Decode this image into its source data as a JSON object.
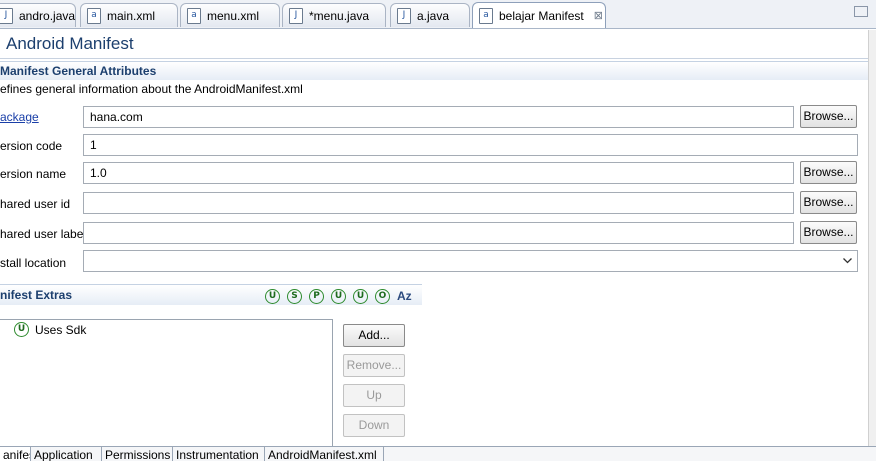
{
  "editor_tabs": [
    {
      "label": "andro.java",
      "icon": "java-file-icon"
    },
    {
      "label": "main.xml",
      "icon": "xml-file-icon"
    },
    {
      "label": "menu.xml",
      "icon": "xml-file-icon"
    },
    {
      "label": "*menu.java",
      "icon": "java-file-icon"
    },
    {
      "label": "a.java",
      "icon": "java-file-icon"
    },
    {
      "label": "belajar Manifest",
      "icon": "manifest-file-icon",
      "active": true
    }
  ],
  "close_glyph": "⊠",
  "title": "Android Manifest",
  "general": {
    "heading": "Manifest General Attributes",
    "description": "efines general information about the AndroidManifest.xml",
    "package_label": "ackage",
    "package_value": "hana.com",
    "version_code_label": "ersion code",
    "version_code_value": "1",
    "version_name_label": "ersion name",
    "version_name_value": "1.0",
    "shared_user_id_label": "hared user id",
    "shared_user_id_value": "",
    "shared_user_label_label": "hared user label",
    "shared_user_label_value": "",
    "install_location_label": "stall location",
    "install_location_value": "",
    "browse_label": "Browse..."
  },
  "extras": {
    "heading": "nifest Extras",
    "toolbar_letters": [
      "U",
      "S",
      "P",
      "U",
      "U",
      "O"
    ],
    "sort_label": "Az",
    "tree_items": [
      {
        "letter": "U",
        "label": "Uses Sdk"
      }
    ],
    "add_label": "Add...",
    "remove_label": "Remove...",
    "up_label": "Up",
    "down_label": "Down"
  },
  "bottom_tabs": [
    "anifest",
    "Application",
    "Permissions",
    "Instrumentation",
    "AndroidManifest.xml"
  ]
}
